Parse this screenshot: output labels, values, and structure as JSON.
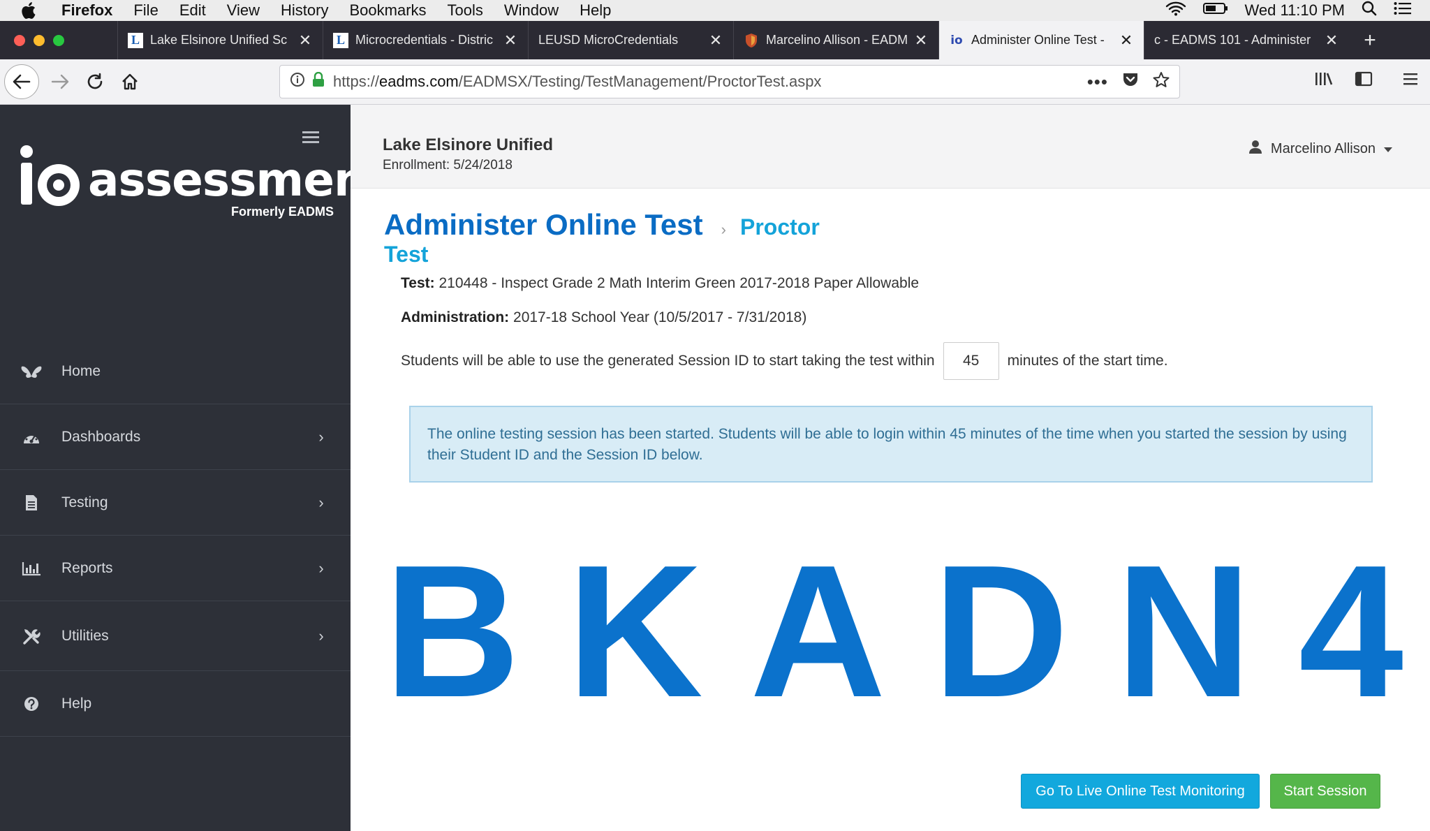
{
  "menubar": {
    "items": [
      "Firefox",
      "File",
      "Edit",
      "View",
      "History",
      "Bookmarks",
      "Tools",
      "Window",
      "Help"
    ],
    "clock": "Wed 11:10 PM"
  },
  "tabs": [
    {
      "label": "Lake Elsinore Unified Sc",
      "favicon": "L",
      "favicon_color": "#1a5fb4"
    },
    {
      "label": "Microcredentials - Distric",
      "favicon": "L",
      "favicon_color": "#1a5fb4"
    },
    {
      "label": "LEUSD MicroCredentials",
      "favicon": "",
      "favicon_color": ""
    },
    {
      "label": "Marcelino Allison - EADM",
      "favicon": "shield",
      "favicon_color": "#c8502a"
    },
    {
      "label": "Administer Online Test -",
      "favicon": "io",
      "favicon_color": "#2e4bb0"
    },
    {
      "label": "c - EADMS 101 - Administer",
      "favicon": "",
      "favicon_color": ""
    }
  ],
  "url": {
    "prefix": "https://",
    "domain": "eadms.com",
    "path": "/EADMSX/Testing/TestManagement/ProctorTest.aspx"
  },
  "sidebar": {
    "logo_text": "assessment",
    "logo_sub": "Formerly EADMS",
    "items": [
      {
        "label": "Home",
        "icon": "butterfly-icon",
        "has_children": false
      },
      {
        "label": "Dashboards",
        "icon": "dashboard-icon",
        "has_children": true
      },
      {
        "label": "Testing",
        "icon": "document-icon",
        "has_children": true
      },
      {
        "label": "Reports",
        "icon": "bar-chart-icon",
        "has_children": true
      },
      {
        "label": "Utilities",
        "icon": "tools-icon",
        "has_children": true
      },
      {
        "label": "Help",
        "icon": "help-icon",
        "has_children": false
      }
    ]
  },
  "header": {
    "org": "Lake Elsinore Unified",
    "enrollment": "Enrollment: 5/24/2018",
    "user": "Marcelino Allison"
  },
  "page": {
    "title": "Administer Online Test",
    "crumb_line1": "Proctor",
    "crumb_line2": "Test",
    "test_label": "Test:",
    "test_value": "210448 - Inspect Grade 2 Math Interim Green 2017-2018 Paper Allowable",
    "admin_label": "Administration:",
    "admin_value": "2017-18 School Year (10/5/2017 - 7/31/2018)",
    "minutes_prefix": "Students will be able to use the generated Session ID to start taking the test within",
    "minutes_value": "45",
    "minutes_suffix": "minutes of the start time.",
    "alert": "The online testing session has been started. Students will be able to login within 45 minutes of the time when you started the session by using their Student ID and the Session ID below.",
    "session_id": [
      "B",
      "K",
      "A",
      "D",
      "N",
      "4"
    ],
    "btn_monitor": "Go To Live Online Test Monitoring",
    "btn_start": "Start Session"
  },
  "colors": {
    "sidebar_bg": "#2d3038",
    "title_blue": "#0a6cc4",
    "session_blue": "#0b72cc",
    "monitor_btn": "#12a8dd",
    "start_btn": "#55b64a"
  }
}
